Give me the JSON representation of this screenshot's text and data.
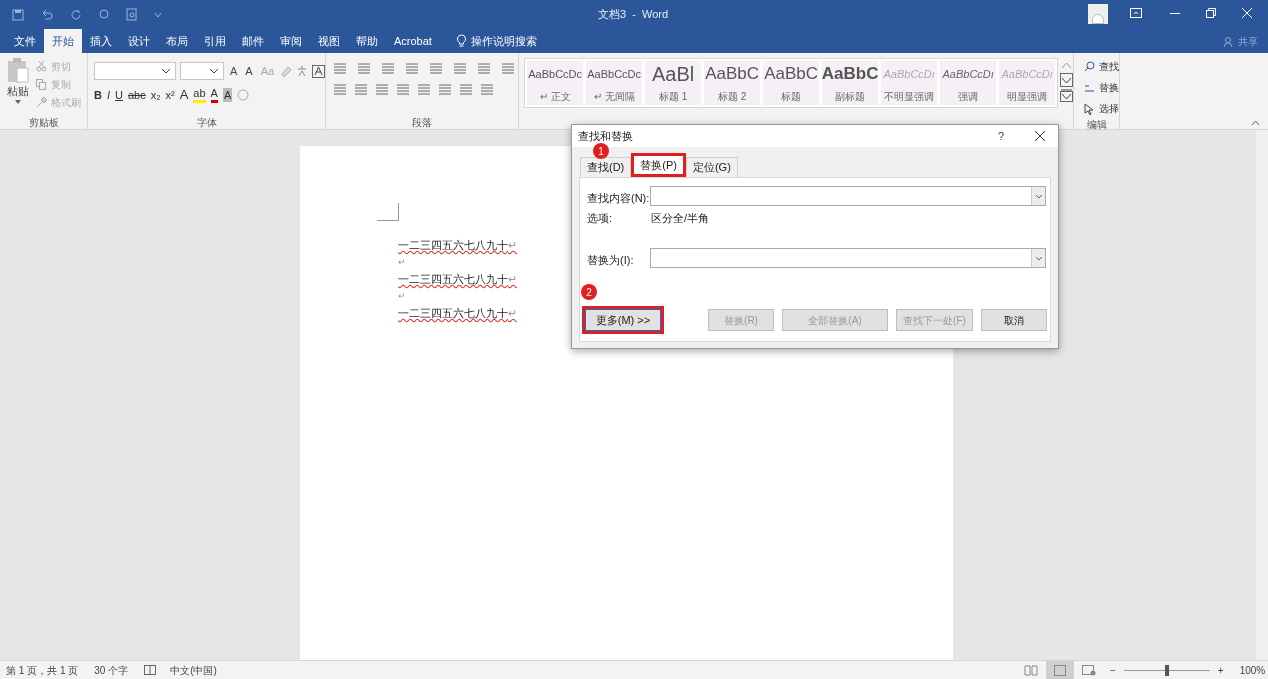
{
  "window": {
    "title": "文档3  -  Word",
    "share": "共享"
  },
  "ribbon_tabs": [
    {
      "label": "文件",
      "selected": false
    },
    {
      "label": "开始",
      "selected": true
    },
    {
      "label": "插入",
      "selected": false
    },
    {
      "label": "设计",
      "selected": false
    },
    {
      "label": "布局",
      "selected": false
    },
    {
      "label": "引用",
      "selected": false
    },
    {
      "label": "邮件",
      "selected": false
    },
    {
      "label": "审阅",
      "selected": false
    },
    {
      "label": "视图",
      "selected": false
    },
    {
      "label": "帮助",
      "selected": false
    },
    {
      "label": "Acrobat",
      "selected": false
    }
  ],
  "tell_me": "操作说明搜索",
  "clipboard": {
    "paste": "粘贴",
    "items": [
      "剪切",
      "复制",
      "格式刷"
    ],
    "label": "剪贴板"
  },
  "font": {
    "label": "字体",
    "top_tools": [
      "A",
      "A",
      "Aa"
    ],
    "bottom_tools": [
      {
        "kind": "bold",
        "text": "B"
      },
      {
        "kind": "italic",
        "text": "I"
      },
      {
        "kind": "underline",
        "text": "U"
      },
      {
        "kind": "strike",
        "text": "abc"
      },
      {
        "kind": "sub",
        "text": "x₂"
      },
      {
        "kind": "sup",
        "text": "x²"
      },
      {
        "kind": "effect",
        "text": "A"
      },
      {
        "kind": "highlight",
        "text": "ab"
      },
      {
        "kind": "color",
        "text": "A"
      },
      {
        "kind": "shade",
        "text": "A"
      }
    ]
  },
  "paragraph": {
    "label": "段落"
  },
  "styles": {
    "items": [
      {
        "kind": "normal",
        "preview": "AaBbCcDc",
        "name": "↵ 正文"
      },
      {
        "kind": "normal",
        "preview": "AaBbCcDc",
        "name": "↵ 无间隔"
      },
      {
        "kind": "heading1",
        "preview": "AaBl",
        "name": "标题 1"
      },
      {
        "kind": "heading",
        "preview": "AaBbC",
        "name": "标题 2"
      },
      {
        "kind": "heading",
        "preview": "AaBbC",
        "name": "标题"
      },
      {
        "kind": "subtitle",
        "preview": "AaBbC",
        "name": "副标题"
      },
      {
        "kind": "subtle",
        "preview": "AaBbCcDı",
        "name": "不明显强调"
      },
      {
        "kind": "emphasis",
        "preview": "AaBbCcDı",
        "name": "强调"
      },
      {
        "kind": "subtle",
        "preview": "AaBbCcDı",
        "name": "明显强调"
      }
    ]
  },
  "editing": {
    "label": "编辑",
    "items": [
      {
        "kind": "find",
        "text": "查找"
      },
      {
        "kind": "replace",
        "text": "替换"
      },
      {
        "kind": "select",
        "text": "选择"
      }
    ]
  },
  "document": {
    "paragraph_mark": "↵",
    "lines": [
      {
        "kind": "text",
        "text": "一二三四五六七八九十"
      },
      {
        "kind": "blank"
      },
      {
        "kind": "text",
        "text": "一二三四五六七八九十"
      },
      {
        "kind": "blank"
      },
      {
        "kind": "text",
        "text": "一二三四五六七八九十"
      }
    ]
  },
  "dialog": {
    "title": "查找和替换",
    "help": "?",
    "tabs": [
      {
        "label": "查找(D)",
        "selected": false
      },
      {
        "label": "替换(P)",
        "selected": true
      },
      {
        "label": "定位(G)",
        "selected": false
      }
    ],
    "find_label": "查找内容(N):",
    "options_label": "选项:",
    "options_value": "区分全/半角",
    "replace_label": "替换为(I):",
    "buttons": [
      {
        "label": "更多(M) >>",
        "disabled": false
      },
      {
        "label": "替换(R)",
        "disabled": true
      },
      {
        "label": "全部替换(A)",
        "disabled": true
      },
      {
        "label": "查找下一处(F)",
        "disabled": true
      },
      {
        "label": "取消",
        "disabled": false
      }
    ],
    "annotations": [
      "1",
      "2"
    ]
  },
  "status_bar": {
    "items": [
      "第 1 页，共 1 页",
      "30 个字",
      "中文(中国)"
    ],
    "zoom_minus": "−",
    "zoom_plus": "+",
    "zoom": "100%",
    "zoom_slider": {
      "level": 0.5
    }
  }
}
